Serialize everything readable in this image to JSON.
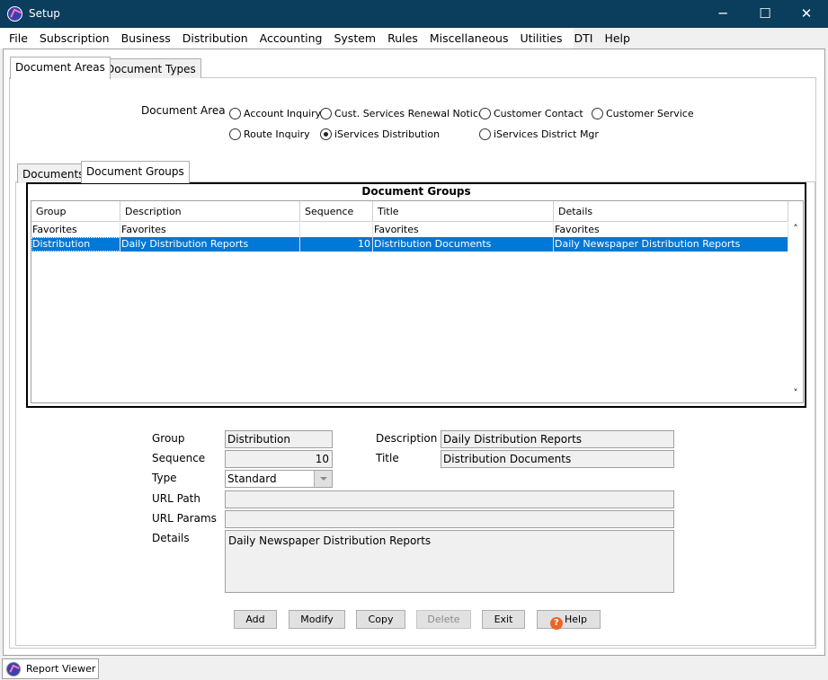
{
  "window": {
    "title": "Setup",
    "controls": {
      "minimize": "─",
      "maximize": "☐",
      "close": "✕"
    }
  },
  "menu": [
    "File",
    "Subscription",
    "Business",
    "Distribution",
    "Accounting",
    "System",
    "Rules",
    "Miscellaneous",
    "Utilities",
    "DTI",
    "Help"
  ],
  "tabs": {
    "document_areas": "Document Areas",
    "document_types": "Document Types"
  },
  "document_area": {
    "label": "Document Area",
    "options": [
      "Account Inquiry",
      "Cust. Services Renewal Notices",
      "Customer Contact",
      "Customer Service",
      "Route Inquiry",
      "iServices Distribution",
      "iServices District Mgr"
    ],
    "selected": "iServices Distribution"
  },
  "subtabs": {
    "documents": "Documents",
    "document_groups": "Document Groups"
  },
  "grid": {
    "title": "Document Groups",
    "columns": [
      "Group",
      "Description",
      "Sequence",
      "Title",
      "Details"
    ],
    "rows": [
      [
        "Favorites",
        "Favorites",
        "",
        "Favorites",
        "Favorites"
      ],
      [
        "Distribution",
        "Daily Distribution Reports",
        "10",
        "Distribution Documents",
        "Daily Newspaper Distribution Reports"
      ]
    ],
    "selected_row": 1,
    "scroll_up": "˄",
    "scroll_down": "˅"
  },
  "form": {
    "group_label": "Group",
    "group_value": "Distribution",
    "sequence_label": "Sequence",
    "sequence_value": "10",
    "type_label": "Type",
    "type_value": "Standard",
    "url_path_label": "URL Path",
    "url_path_value": "",
    "url_params_label": "URL Params",
    "url_params_value": "",
    "details_label": "Details",
    "details_value": "Daily Newspaper Distribution Reports",
    "description_label": "Description",
    "description_value": "Daily Distribution Reports",
    "title_label": "Title",
    "title_value": "Distribution Documents"
  },
  "buttons": {
    "add": "Add",
    "modify": "Modify",
    "copy": "Copy",
    "delete": "Delete",
    "exit": "Exit",
    "help": "Help"
  },
  "taskbar": {
    "report_viewer": "Report Viewer"
  },
  "colors": {
    "titlebar": "#0b3d5c",
    "selection": "#0078d7"
  }
}
